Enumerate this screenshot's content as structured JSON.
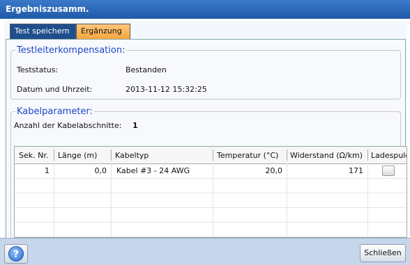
{
  "window": {
    "title": "Ergebniszusamm."
  },
  "tabs": [
    {
      "label": "Test speichern"
    },
    {
      "label": "Ergänzung"
    }
  ],
  "testleiter": {
    "legend": "Testleiterkompensation:",
    "status_label": "Teststatus:",
    "status_value": "Bestanden",
    "datetime_label": "Datum und Uhrzeit:",
    "datetime_value": "2013-11-12 15:32:25"
  },
  "kabel": {
    "legend": "Kabelparameter:",
    "sections_label": "Anzahl der Kabelabschnitte:",
    "sections_value": "1",
    "columns": [
      "Sek. Nr.",
      "Länge (m)",
      "Kabeltyp",
      "Temperatur (°C)",
      "Widerstand (Ω/km)",
      "Ladespule"
    ],
    "rows": [
      {
        "sek": "1",
        "laenge": "0,0",
        "kabeltyp": "Kabel #3 - 24 AWG",
        "temperatur": "20,0",
        "widerstand": "171",
        "ladespule": false
      }
    ]
  },
  "footer": {
    "help_icon": "question-icon",
    "close_label": "Schließen"
  }
}
